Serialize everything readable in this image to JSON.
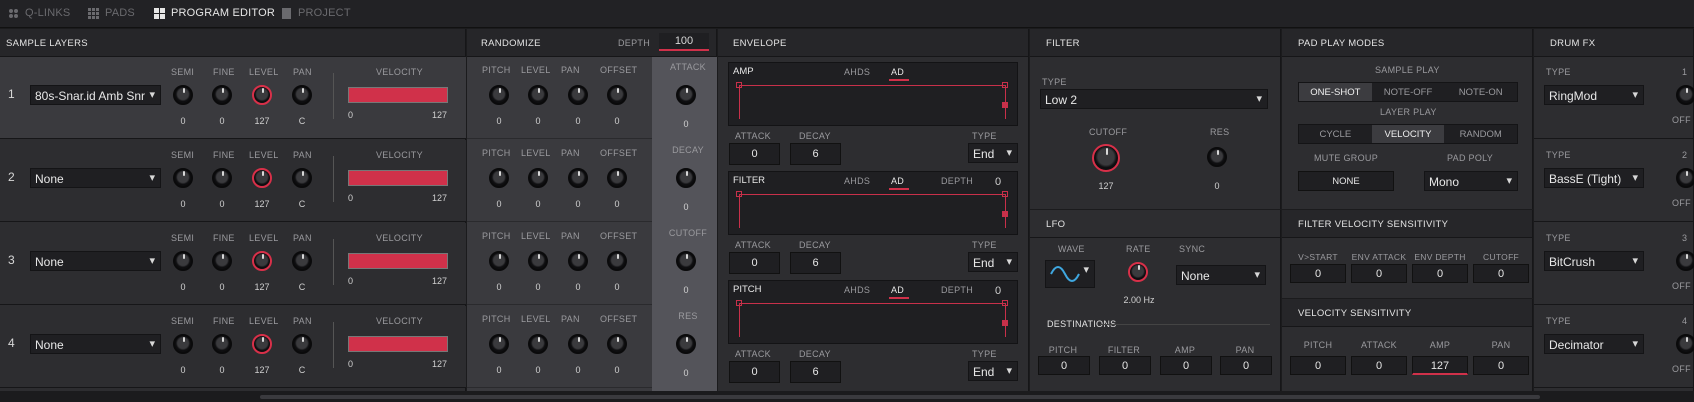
{
  "tabs": [
    {
      "label": "Q-LINKS"
    },
    {
      "label": "PADS"
    },
    {
      "label": "PROGRAM EDITOR"
    },
    {
      "label": "PROJECT"
    }
  ],
  "sample_layers": {
    "title": "SAMPLE LAYERS",
    "headers": {
      "semi": "SEMI",
      "fine": "FINE",
      "level": "LEVEL",
      "pan": "PAN",
      "velocity": "VELOCITY"
    },
    "rows": [
      {
        "num": "1",
        "sample": "80s-Snar.id Amb Snr",
        "semi": "0",
        "fine": "0",
        "level": "127",
        "pan": "C",
        "vel_min": "0",
        "vel_max": "127"
      },
      {
        "num": "2",
        "sample": "None",
        "semi": "0",
        "fine": "0",
        "level": "127",
        "pan": "C",
        "vel_min": "0",
        "vel_max": "127"
      },
      {
        "num": "3",
        "sample": "None",
        "semi": "0",
        "fine": "0",
        "level": "127",
        "pan": "C",
        "vel_min": "0",
        "vel_max": "127"
      },
      {
        "num": "4",
        "sample": "None",
        "semi": "0",
        "fine": "0",
        "level": "127",
        "pan": "C",
        "vel_min": "0",
        "vel_max": "127"
      }
    ]
  },
  "randomize": {
    "title": "RANDOMIZE",
    "depth_label": "DEPTH",
    "depth": "100",
    "headers": {
      "pitch": "PITCH",
      "level": "LEVEL",
      "pan": "PAN",
      "offset": "OFFSET"
    },
    "rows": [
      {
        "v": [
          "0",
          "0",
          "0",
          "0"
        ]
      },
      {
        "v": [
          "0",
          "0",
          "0",
          "0"
        ]
      },
      {
        "v": [
          "0",
          "0",
          "0",
          "0"
        ]
      },
      {
        "v": [
          "0",
          "0",
          "0",
          "0"
        ]
      }
    ],
    "side": [
      {
        "label": "ATTACK",
        "value": "0"
      },
      {
        "label": "DECAY",
        "value": "0"
      },
      {
        "label": "CUTOFF",
        "value": "0"
      },
      {
        "label": "RES",
        "value": "0"
      }
    ]
  },
  "envelope": {
    "title": "ENVELOPE",
    "ahds": "AHDS",
    "ad": "AD",
    "depth_label": "DEPTH",
    "attack_label": "ATTACK",
    "decay_label": "DECAY",
    "type_label": "TYPE",
    "blocks": [
      {
        "name": "AMP",
        "depth": "",
        "attack": "0",
        "decay": "6",
        "type": "End"
      },
      {
        "name": "FILTER",
        "depth": "0",
        "attack": "0",
        "decay": "6",
        "type": "End"
      },
      {
        "name": "PITCH",
        "depth": "0",
        "attack": "0",
        "decay": "6",
        "type": "End"
      }
    ]
  },
  "filter": {
    "title": "FILTER",
    "type_label": "TYPE",
    "type": "Low 2",
    "cutoff_label": "CUTOFF",
    "cutoff": "127",
    "res_label": "RES",
    "res": "0"
  },
  "lfo": {
    "title": "LFO",
    "wave_label": "WAVE",
    "rate_label": "RATE",
    "rate": "2.00 Hz",
    "sync_label": "SYNC",
    "sync": "None",
    "dest_title": "DESTINATIONS",
    "dest": [
      {
        "label": "PITCH",
        "value": "0"
      },
      {
        "label": "FILTER",
        "value": "0"
      },
      {
        "label": "AMP",
        "value": "0"
      },
      {
        "label": "PAN",
        "value": "0"
      }
    ]
  },
  "pad_play": {
    "title": "PAD PLAY MODES",
    "sample_play_label": "SAMPLE PLAY",
    "sample_play": [
      "ONE-SHOT",
      "NOTE-OFF",
      "NOTE-ON"
    ],
    "layer_play_label": "LAYER PLAY",
    "layer_play": [
      "CYCLE",
      "VELOCITY",
      "RANDOM"
    ],
    "mute_group_label": "MUTE GROUP",
    "mute_group": "NONE",
    "pad_poly_label": "PAD POLY",
    "pad_poly": "Mono"
  },
  "filter_vel": {
    "title": "FILTER VELOCITY SENSITIVITY",
    "items": [
      {
        "label": "V>START",
        "value": "0"
      },
      {
        "label": "ENV ATTACK",
        "value": "0"
      },
      {
        "label": "ENV DEPTH",
        "value": "0"
      },
      {
        "label": "CUTOFF",
        "value": "0"
      }
    ]
  },
  "vel_sens": {
    "title": "VELOCITY SENSITIVITY",
    "items": [
      {
        "label": "PITCH",
        "value": "0"
      },
      {
        "label": "ATTACK",
        "value": "0"
      },
      {
        "label": "AMP",
        "value": "127"
      },
      {
        "label": "PAN",
        "value": "0"
      }
    ]
  },
  "drum_fx": {
    "title": "DRUM FX",
    "type_label": "TYPE",
    "off_label": "OFF",
    "slots": [
      {
        "num": "1",
        "type": "RingMod"
      },
      {
        "num": "2",
        "type": "BassE (Tight)"
      },
      {
        "num": "3",
        "type": "BitCrush"
      },
      {
        "num": "4",
        "type": "Decimator"
      }
    ]
  },
  "colors": {
    "accent": "#d0314a",
    "panel": "#2d2d30",
    "bg": "#1b1b1d"
  }
}
